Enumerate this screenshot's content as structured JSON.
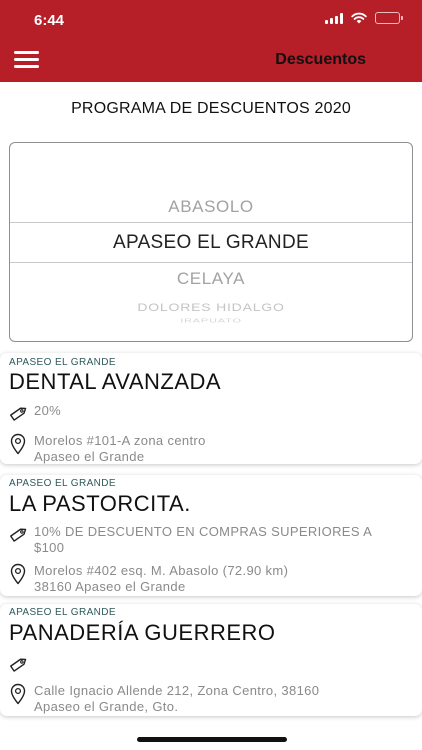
{
  "status_bar": {
    "time": "6:44"
  },
  "header": {
    "title": "Descuentos"
  },
  "program_title": "PROGRAMA DE DESCUENTOS 2020",
  "picker": {
    "items": [
      "ABASOLO",
      "APASEO EL GRANDE",
      "CELAYA",
      "DOLORES HIDALGO",
      "IRAPUATO"
    ],
    "selected": "APASEO EL GRANDE"
  },
  "businesses": [
    {
      "city": "APASEO EL GRANDE",
      "name": "DENTAL AVANZADA",
      "discount": "20%",
      "address_line1": "Morelos #101-A zona centro",
      "address_line2": "Apaseo el Grande"
    },
    {
      "city": "APASEO EL GRANDE",
      "name": "LA PASTORCITA.",
      "discount_line1": "10% DE DESCUENTO EN COMPRAS SUPERIORES A",
      "discount_line2": "$100",
      "address_line1": "Morelos #402 esq. M. Abasolo (72.90 km)",
      "address_line2": "38160 Apaseo el Grande"
    },
    {
      "city": "APASEO EL GRANDE",
      "name": "PANADERÍA GUERRERO",
      "discount": "",
      "address_line1": "Calle Ignacio Allende 212, Zona Centro, 38160",
      "address_line2": "Apaseo el Grande, Gto."
    }
  ],
  "colors": {
    "brand": "#b61e28",
    "city_label": "#2d5a5a",
    "muted_text": "#8a8a8a"
  },
  "icons": {
    "menu": "hamburger-icon",
    "discount": "price-tag-icon",
    "location": "map-pin-icon"
  }
}
